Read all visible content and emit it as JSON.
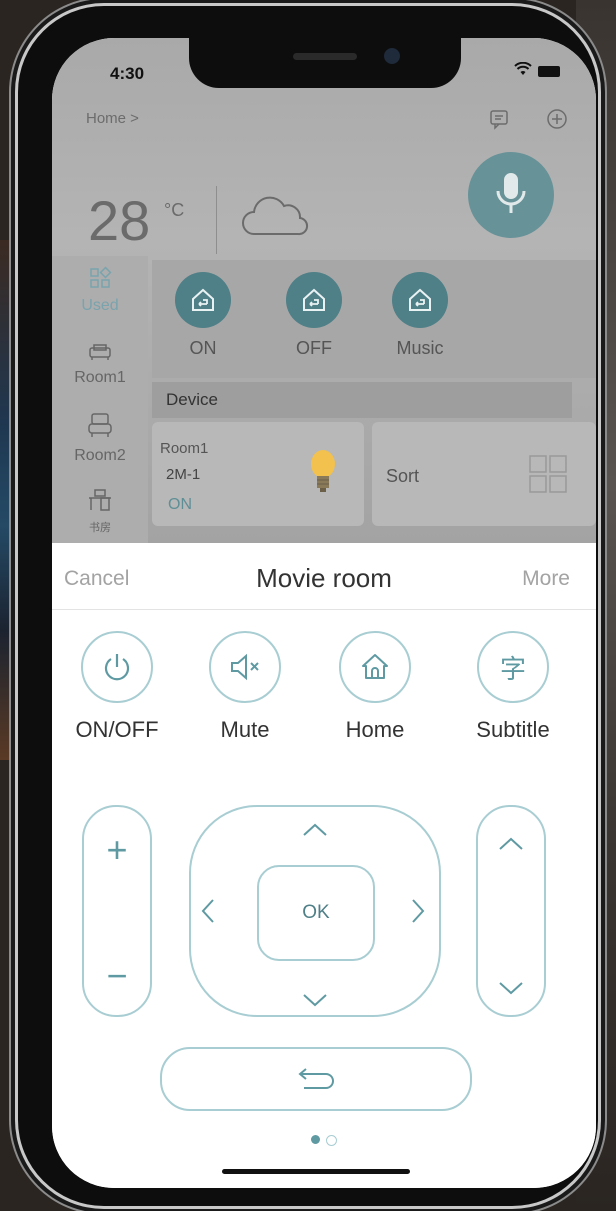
{
  "status_bar": {
    "time": "4:30"
  },
  "header": {
    "breadcrumb": "Home >"
  },
  "weather": {
    "temperature": "28",
    "unit": "°C"
  },
  "side_nav": {
    "items": [
      {
        "label": "Used",
        "icon": "grid-icon",
        "active": true
      },
      {
        "label": "Room1",
        "icon": "sofa-icon",
        "active": false
      },
      {
        "label": "Room2",
        "icon": "couch-icon",
        "active": false
      },
      {
        "label": "书房",
        "icon": "desk-icon",
        "active": false
      }
    ]
  },
  "scenes": [
    {
      "label": "ON",
      "icon": "home-scene-icon"
    },
    {
      "label": "OFF",
      "icon": "home-scene-icon"
    },
    {
      "label": "Music",
      "icon": "home-scene-icon"
    }
  ],
  "device_section": {
    "label": "Device"
  },
  "device_card": {
    "room": "Room1",
    "name": "2M-1",
    "state": "ON",
    "icon": "bulb-icon"
  },
  "sort_card": {
    "label": "Sort",
    "icon": "grid-icon"
  },
  "remote": {
    "title": "Movie room",
    "cancel_label": "Cancel",
    "more_label": "More",
    "functions": [
      {
        "label": "ON/OFF",
        "icon": "power-icon"
      },
      {
        "label": "Mute",
        "icon": "mute-icon"
      },
      {
        "label": "Home",
        "icon": "home-icon"
      },
      {
        "label": "Subtitle",
        "icon": "subtitle-icon",
        "glyph": "字"
      }
    ],
    "volume": {
      "up": "+",
      "down": "−"
    },
    "dpad": {
      "ok_label": "OK"
    },
    "pagination": {
      "current": 1,
      "total": 2
    }
  },
  "colors": {
    "accent": "#5f9aa3",
    "accent_border": "#a8cdd2",
    "scene_button": "#4f7f87",
    "mic_button": "#5f8f96"
  }
}
